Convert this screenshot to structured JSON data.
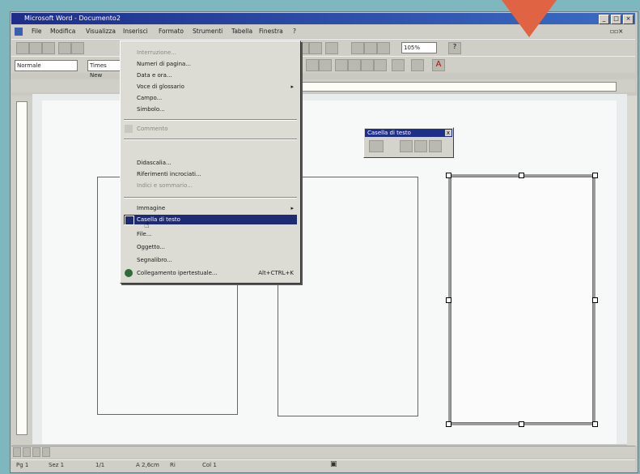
{
  "window": {
    "title": "Microsoft Word - Documento2"
  },
  "menubar": {
    "items": [
      "File",
      "Modifica",
      "Visualizza",
      "Inserisci",
      "Formato",
      "Strumenti",
      "Tabella",
      "Finestra",
      "?"
    ]
  },
  "toolbar": {
    "zoom_value": "105%",
    "help_label": "?"
  },
  "format_toolbar": {
    "style_value": "Normale",
    "font_value": "Times New"
  },
  "insert_menu": {
    "items": [
      {
        "label": "Interruzione..."
      },
      {
        "label": "Numeri di pagina..."
      },
      {
        "label": "Data e ora..."
      },
      {
        "label": "Voce di glossario",
        "submenu": true
      },
      {
        "label": "Campo..."
      },
      {
        "label": "Simbolo..."
      },
      {
        "label": "Commento"
      },
      {
        "label": "Didascalia..."
      },
      {
        "label": "Riferimenti incrociati..."
      },
      {
        "label": "Indici e sommario..."
      },
      {
        "label": "Immagine",
        "submenu": true
      },
      {
        "label": "Casella di testo"
      },
      {
        "label": "File..."
      },
      {
        "label": "Oggetto..."
      },
      {
        "label": "Segnalibro..."
      },
      {
        "label": "Collegamento ipertestuale...",
        "shortcut": "Alt+CTRL+K"
      }
    ]
  },
  "textbox_toolbar": {
    "title": "Casella di testo",
    "close": "x"
  },
  "statusbar": {
    "page": "Pg 1",
    "section": "Sez 1",
    "pages": "1/1",
    "position": "A 2,6cm",
    "line": "Ri",
    "column": "Col 1"
  },
  "colors": {
    "arrow": "#e06343",
    "title_bar": "#1d2d8a",
    "menu_highlight": "#1e2a72"
  }
}
